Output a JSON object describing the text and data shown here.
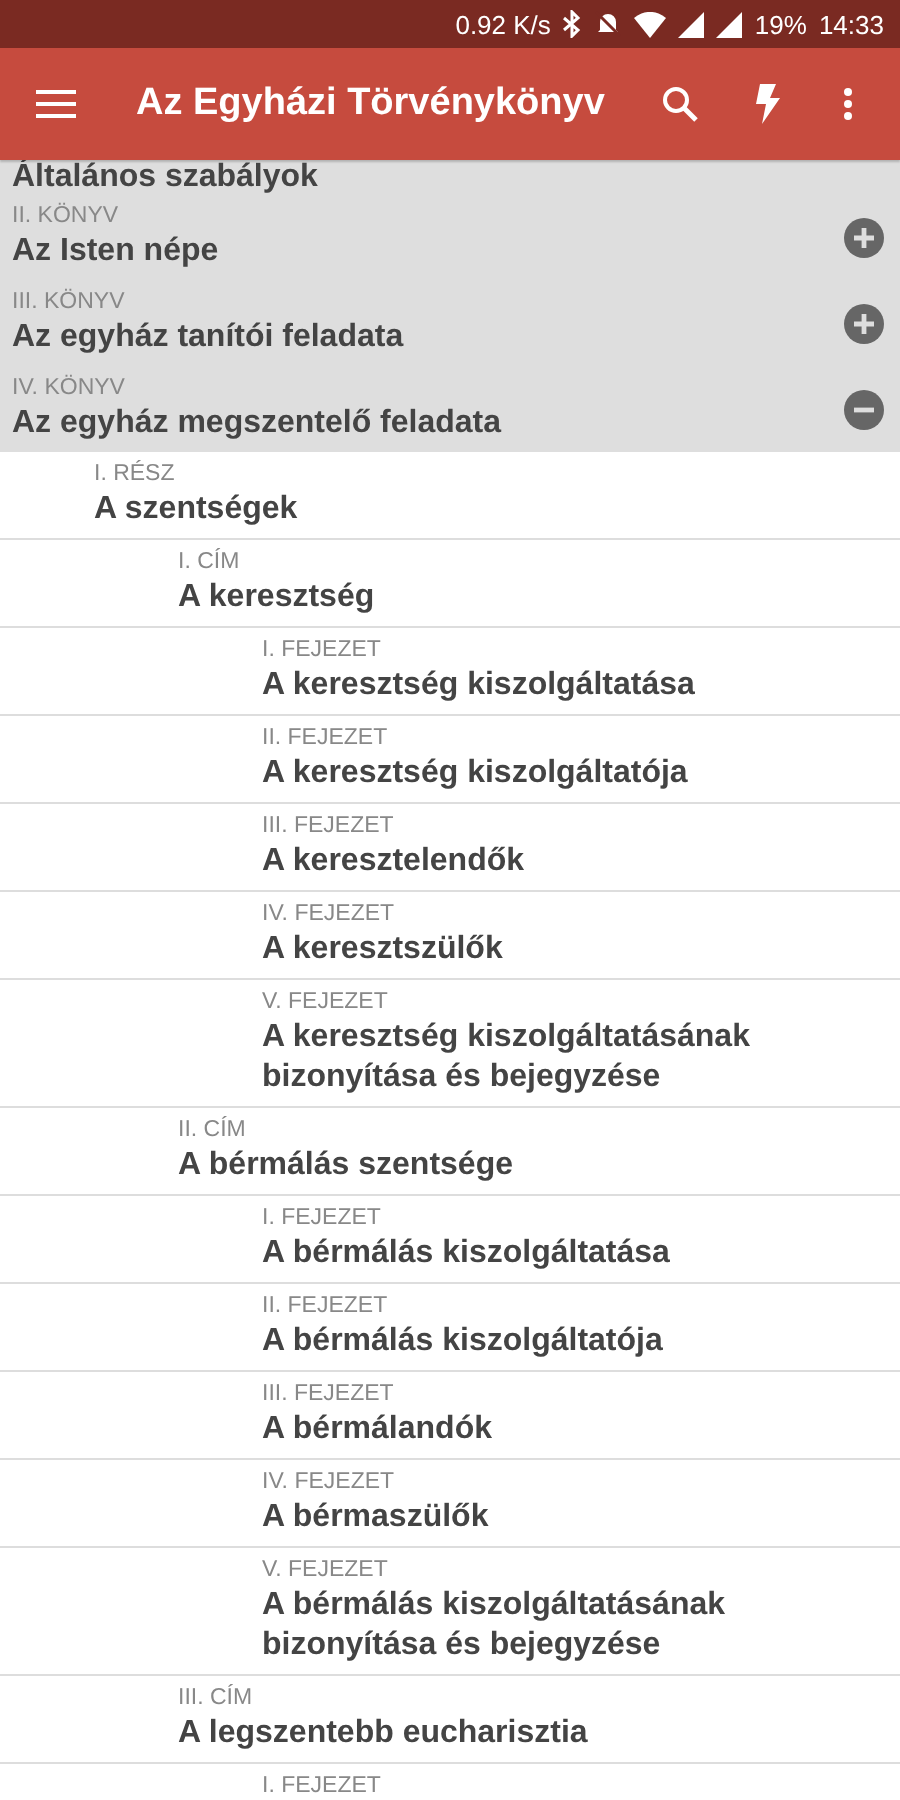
{
  "status_bar": {
    "speed": "0.92 K/s",
    "battery": "19%",
    "time": "14:33"
  },
  "app_bar": {
    "title": "Az Egyházi Törvénykönyv"
  },
  "tree": [
    {
      "title": "Általános szabályok",
      "kind": "partial"
    },
    {
      "label": "II. KÖNYV",
      "title": "Az Isten népe",
      "expanded": false
    },
    {
      "label": "III. KÖNYV",
      "title": "Az egyház tanítói feladata",
      "expanded": false
    },
    {
      "label": "IV. KÖNYV",
      "title": "Az egyház megszentelő feladata",
      "expanded": true,
      "children": [
        {
          "label": "I. RÉSZ",
          "title": "A szentségek",
          "children": [
            {
              "label": "I. CÍM",
              "title": "A keresztség",
              "children": [
                {
                  "label": "I. FEJEZET",
                  "title": "A keresztség kiszolgáltatása"
                },
                {
                  "label": "II. FEJEZET",
                  "title": "A keresztség kiszolgáltatója"
                },
                {
                  "label": "III. FEJEZET",
                  "title": "A keresztelendők"
                },
                {
                  "label": "IV. FEJEZET",
                  "title": "A keresztszülők"
                },
                {
                  "label": "V. FEJEZET",
                  "title": "A keresztség kiszolgáltatásának bizonyítása és bejegyzése"
                }
              ]
            },
            {
              "label": "II. CÍM",
              "title": "A bérmálás szentsége",
              "children": [
                {
                  "label": "I. FEJEZET",
                  "title": "A bérmálás kiszolgáltatása"
                },
                {
                  "label": "II. FEJEZET",
                  "title": "A bérmálás kiszolgáltatója"
                },
                {
                  "label": "III. FEJEZET",
                  "title": "A bérmálandók"
                },
                {
                  "label": "IV. FEJEZET",
                  "title": "A bérmaszülők"
                },
                {
                  "label": "V. FEJEZET",
                  "title": "A bérmálás kiszolgáltatásának bizonyítása és bejegyzése"
                }
              ]
            },
            {
              "label": "III. CÍM",
              "title": "A legszentebb eucharisztia",
              "children": [
                {
                  "label": "I. FEJEZET"
                }
              ]
            }
          ]
        }
      ]
    }
  ]
}
